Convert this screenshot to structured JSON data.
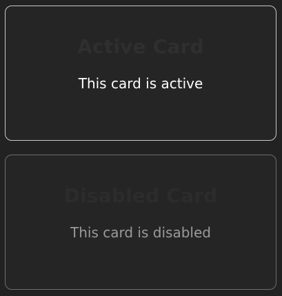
{
  "cards": [
    {
      "title": "Active Card",
      "body": "This card is active",
      "state": "active",
      "border_color": "#c9c9c9"
    },
    {
      "title": "Disabled Card",
      "body": "This card is disabled",
      "state": "disabled",
      "border_color": "#6e6e6e"
    }
  ]
}
